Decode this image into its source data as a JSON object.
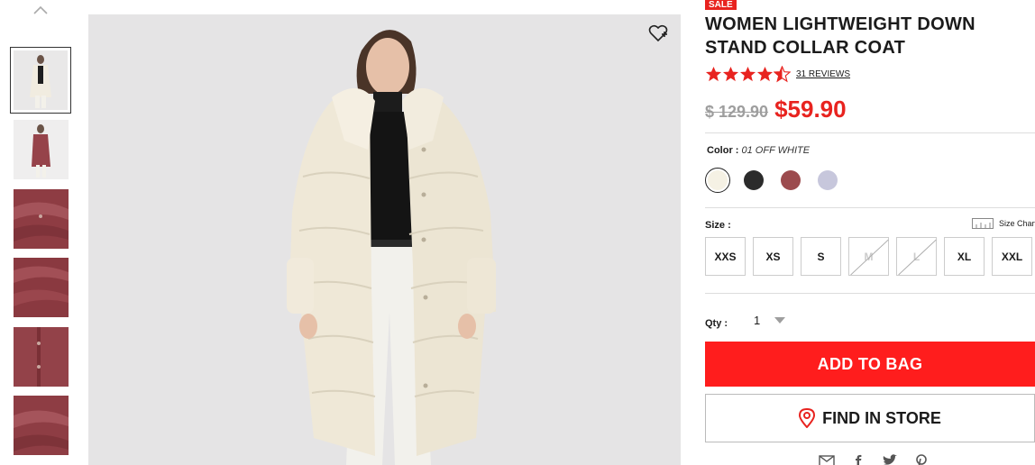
{
  "product": {
    "badge": "SALE",
    "title": "WOMEN LIGHTWEIGHT DOWN STAND COLLAR COAT",
    "rating": 4.5,
    "reviews": "31 REVIEWS",
    "original_price": "$ 129.90",
    "sale_price": "$59.90"
  },
  "colors": {
    "label": "Color : ",
    "selected": "01 OFF WHITE",
    "options": [
      {
        "name": "off-white",
        "hex": "#f5f1e4"
      },
      {
        "name": "black",
        "hex": "#2b2b2b"
      },
      {
        "name": "wine",
        "hex": "#9c4b4e"
      },
      {
        "name": "lavender",
        "hex": "#c7c7dc"
      }
    ]
  },
  "sizes": {
    "label": "Size :",
    "chart_link": "Size Chart",
    "options": [
      {
        "label": "XXS",
        "available": true
      },
      {
        "label": "XS",
        "available": true
      },
      {
        "label": "S",
        "available": true
      },
      {
        "label": "M",
        "available": false
      },
      {
        "label": "L",
        "available": false
      },
      {
        "label": "XL",
        "available": true
      },
      {
        "label": "XXL",
        "available": true
      }
    ]
  },
  "quantity": {
    "label": "Qty :",
    "value": "1"
  },
  "actions": {
    "add_to_bag": "ADD TO BAG",
    "find_in_store": "FIND IN STORE"
  },
  "accent_color": "#ff1d1d",
  "gallery": {
    "thumb_colors": [
      "#e9e6e3",
      "#9c4b4e",
      "#913e44",
      "#8a3a40",
      "#93434a",
      "#8e3d44"
    ],
    "selected_index": 0
  }
}
